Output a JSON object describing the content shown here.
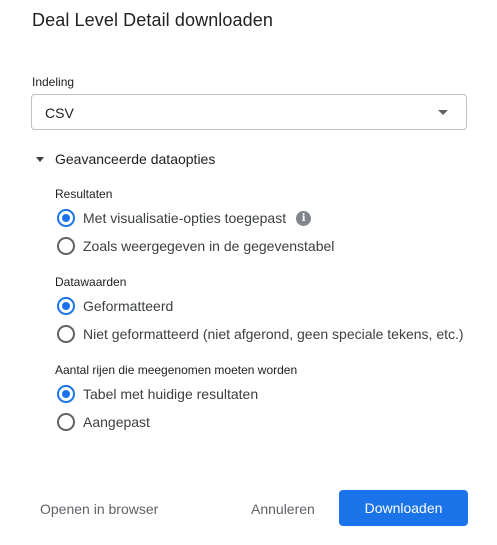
{
  "dialog": {
    "title": "Deal Level Detail downloaden"
  },
  "format": {
    "label": "Indeling",
    "selected": "CSV"
  },
  "advanced": {
    "label": "Geavanceerde dataopties",
    "expanded": true
  },
  "results": {
    "label": "Resultaten",
    "options": [
      {
        "label": "Met visualisatie-opties toegepast",
        "checked": true,
        "icon": "info-icon"
      },
      {
        "label": "Zoals weergegeven in de gegevenstabel",
        "checked": false
      }
    ]
  },
  "data_values": {
    "label": "Datawaarden",
    "options": [
      {
        "label": "Geformatteerd",
        "checked": true
      },
      {
        "label": "Niet geformatteerd (niet afgerond, geen speciale tekens, etc.)",
        "checked": false
      }
    ]
  },
  "row_count": {
    "label": "Aantal rijen die meegenomen moeten worden",
    "options": [
      {
        "label": "Tabel met huidige resultaten",
        "checked": true
      },
      {
        "label": "Aangepast",
        "checked": false
      }
    ]
  },
  "footer": {
    "open_in_browser": "Openen in browser",
    "cancel": "Annuleren",
    "download": "Downloaden"
  },
  "colors": {
    "accent": "#1a73e8",
    "text": "#3c4043",
    "title": "#202124"
  }
}
